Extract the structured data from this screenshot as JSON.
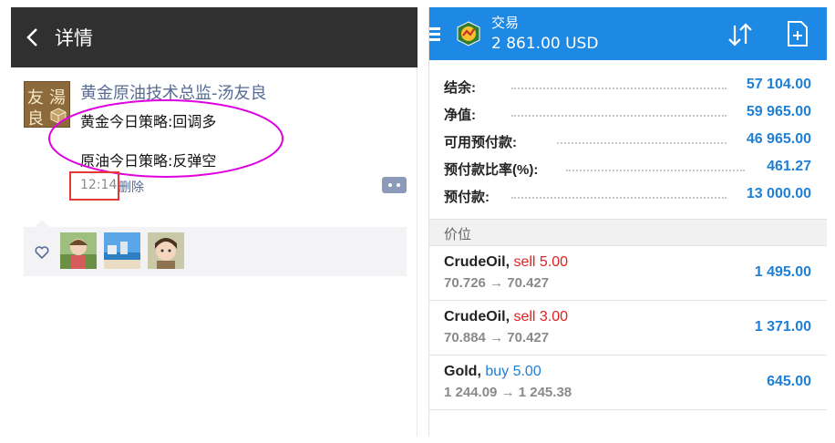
{
  "wechat": {
    "header": {
      "back_label": "详情"
    },
    "post": {
      "avatar_chars": [
        "友",
        "湯",
        "良"
      ],
      "author": "黄金原油技术总监-汤友良",
      "line1": "黄金今日策略:回调多",
      "line2": "原油今日策略:反弹空",
      "time": "12:14",
      "delete_label": "删除"
    },
    "likes": {
      "count": 3
    }
  },
  "trade": {
    "header": {
      "title": "交易",
      "balance": "2 861.00 USD"
    },
    "account": [
      {
        "label": "结余:",
        "value": "57 104.00"
      },
      {
        "label": "净值:",
        "value": "59 965.00"
      },
      {
        "label": "可用预付款:",
        "value": "46 965.00"
      },
      {
        "label": "预付款比率(%):",
        "value": "461.27"
      },
      {
        "label": "预付款:",
        "value": "13 000.00"
      }
    ],
    "section_label": "价位",
    "positions": [
      {
        "symbol": "CrudeOil,",
        "side": "sell 5.00",
        "side_type": "sell",
        "open": "70.726",
        "arrow": "→",
        "current": "70.427",
        "profit": "1 495.00"
      },
      {
        "symbol": "CrudeOil,",
        "side": "sell 3.00",
        "side_type": "sell",
        "open": "70.884",
        "arrow": "→",
        "current": "70.427",
        "profit": "1 371.00"
      },
      {
        "symbol": "Gold,",
        "side": "buy 5.00",
        "side_type": "buy",
        "open": "1 244.09",
        "arrow": "→",
        "current": "1 245.38",
        "profit": "645.00"
      }
    ]
  },
  "colors": {
    "wechat_header": "#303030",
    "wechat_link": "#576b95",
    "annotation_ellipse": "#e000e0",
    "annotation_box": "#e53935",
    "mt4_header": "#1e88e5",
    "mt4_value": "#1e7fd6",
    "sell": "#e02020"
  }
}
